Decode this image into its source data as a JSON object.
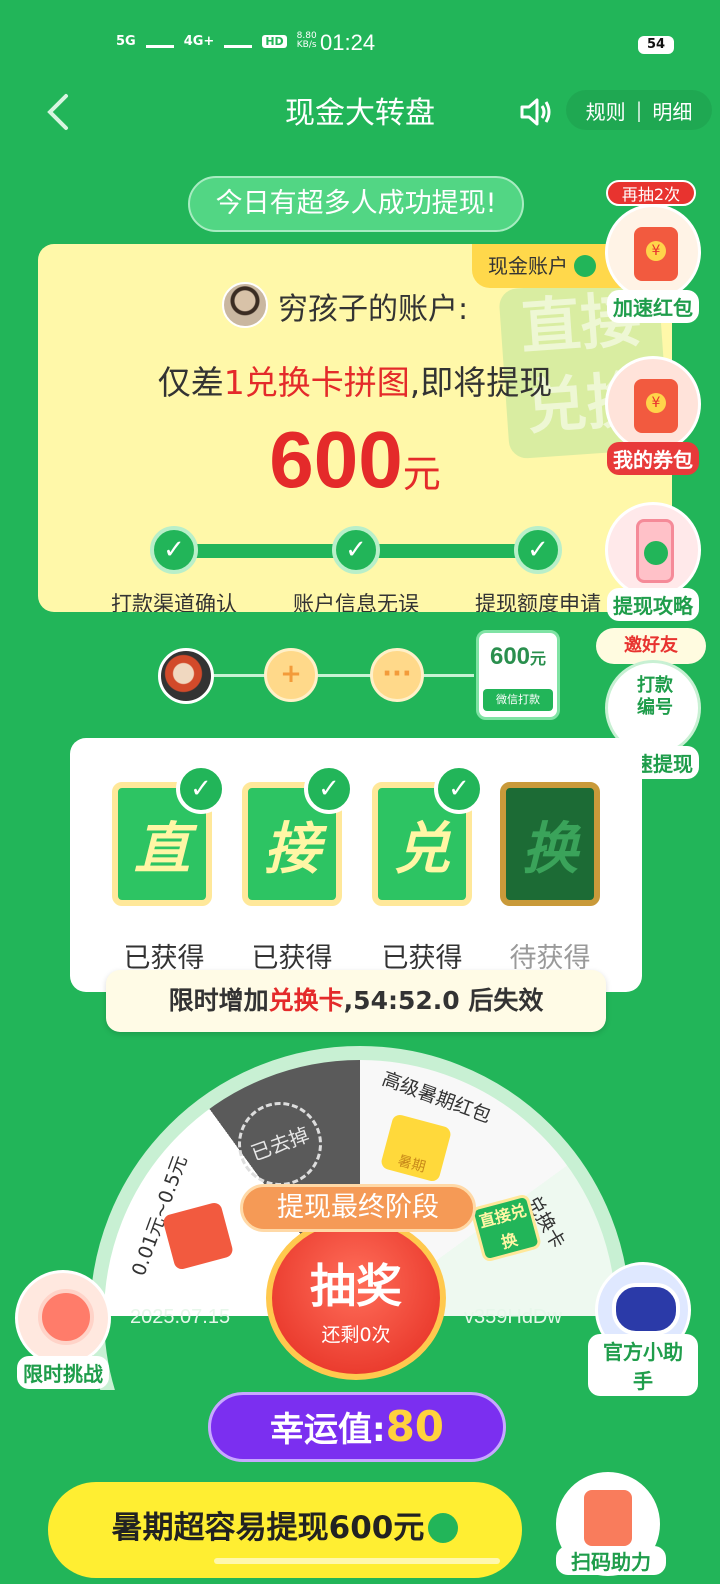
{
  "status_bar": {
    "network1": "5G",
    "network2": "4G+",
    "hd": "HD",
    "speed": "8.80",
    "speed_unit": "KB/s",
    "time": "01:24",
    "battery": "54"
  },
  "header": {
    "title": "现金大转盘",
    "rules": "规则",
    "details": "明细"
  },
  "banner": "今日有超多人成功提现!",
  "account": {
    "tag": "现金账户",
    "owner": "穷孩子的账户:",
    "hint_prefix": "仅差",
    "hint_red": "1兑换卡拼图",
    "hint_suffix": ",即将提现",
    "amount": "600",
    "unit": "元",
    "watermark_1": "直接",
    "watermark_2": "兑换",
    "steps": [
      "打款渠道确认",
      "账户信息无误",
      "提现额度申请"
    ]
  },
  "side": {
    "again_badge": "再抽2次",
    "speed_redpacket": "加速红包",
    "my_coupons": "我的券包",
    "strategy": "提现攻略",
    "invite": "邀好友",
    "pay_number": "打款编号",
    "speed_withdraw": "加速提现"
  },
  "flow": {
    "plus": "+",
    "more": "···",
    "card_value": "600",
    "card_unit": "元",
    "card_foot": "微信打款"
  },
  "pieces": [
    {
      "char": "直",
      "status": "已获得"
    },
    {
      "char": "接",
      "status": "已获得"
    },
    {
      "char": "兑",
      "status": "已获得"
    },
    {
      "char": "换",
      "status": "待获得"
    }
  ],
  "timer": {
    "prefix": "限时增加",
    "highlight": "兑换卡",
    "suffix": ",54:52.0 后失效"
  },
  "wheel": {
    "slot_premium": "高级暑期红包",
    "slot_card": "兑换卡",
    "slot_cash": "0.01元~0.5元",
    "stamp": "已去掉",
    "premium_badge": "暑期",
    "card_badge": "直接兑换",
    "date": "2025.07.15",
    "code": "v359HdDw",
    "stage": "提现最终阶段",
    "spin": "抽奖",
    "remaining": "还剩0次"
  },
  "luck": {
    "label": "幸运值:",
    "value": "80"
  },
  "challenge": "限时挑战",
  "assistant": "官方小助手",
  "cta": "暑期超容易提现600元",
  "scan": "扫码助力",
  "colors": {
    "primary_green": "#22b559",
    "card_yellow": "#fff8a9",
    "accent_red": "#e42a2a",
    "purple": "#7b2ff0"
  }
}
